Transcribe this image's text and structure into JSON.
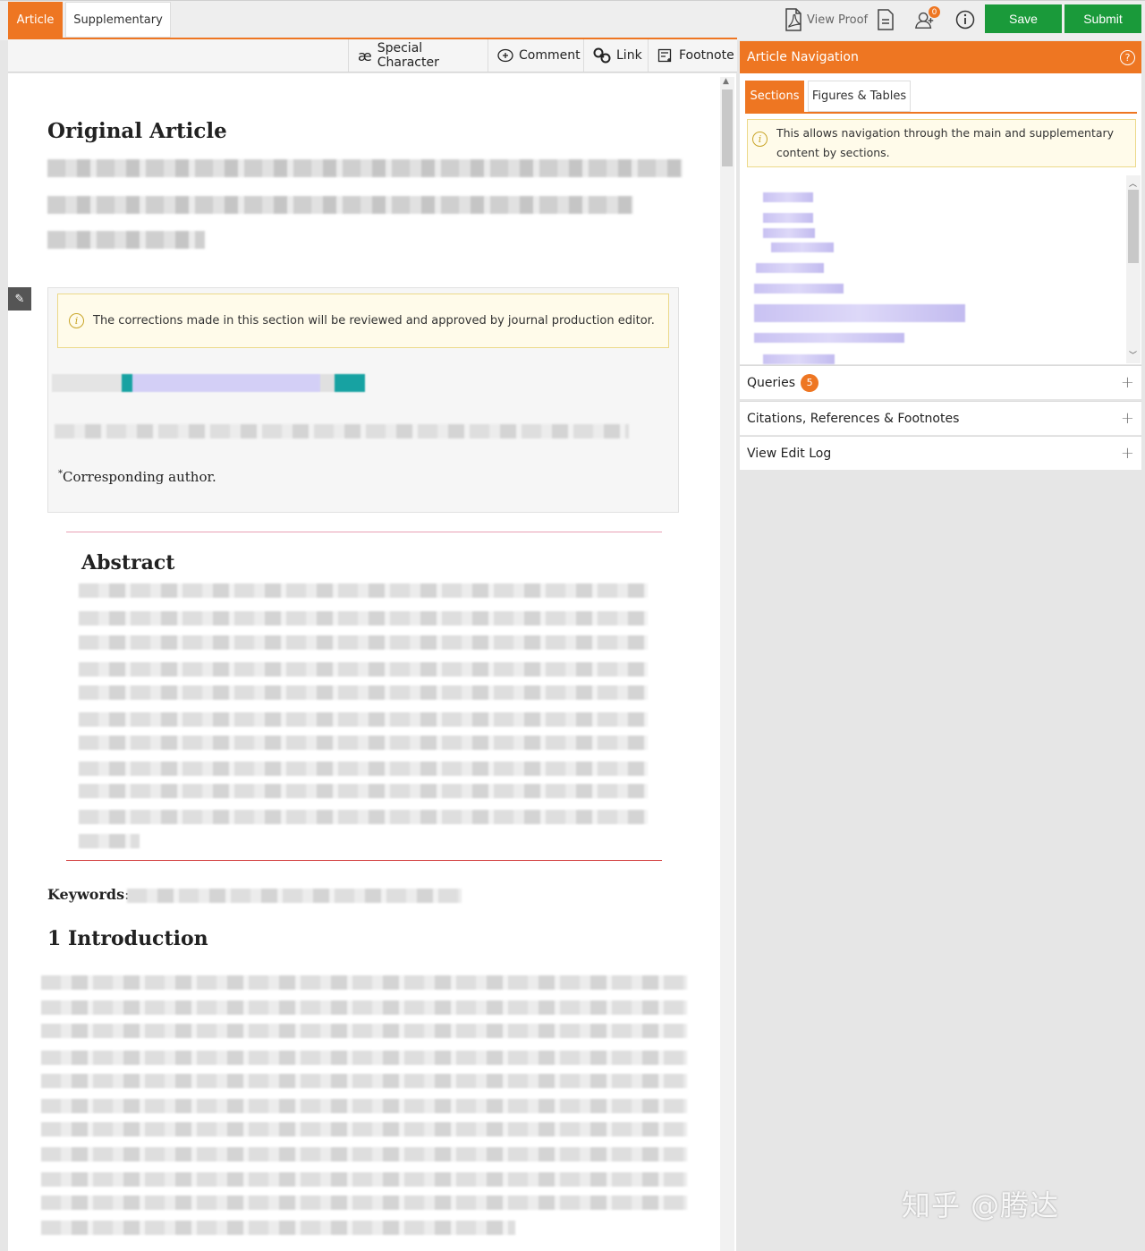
{
  "tabs": {
    "article": "Article",
    "supplementary": "Supplementary"
  },
  "topbar": {
    "view_proof": "View Proof",
    "notification_count": "0",
    "save": "Save",
    "submit": "Submit"
  },
  "toolbar": {
    "special_character": "Special Character",
    "comment": "Comment",
    "link": "Link",
    "footnote": "Footnote"
  },
  "document": {
    "article_type": "Original Article",
    "notice": "The corrections made in this section will be reviewed and approved by journal production editor.",
    "corresponding_mark": "*",
    "corresponding_author": "Corresponding author.",
    "abstract_heading": "Abstract",
    "keywords_label": "Keywords",
    "keywords_sep": ":",
    "intro_heading": "1 Introduction"
  },
  "navigation": {
    "title": "Article Navigation",
    "help": "?",
    "tab_sections": "Sections",
    "tab_figures": "Figures & Tables",
    "notice": "This allows navigation through the main and supplementary content by sections.",
    "accordions": {
      "queries": "Queries",
      "queries_count": "5",
      "citations": "Citations, References & Footnotes",
      "edit_log": "View Edit Log"
    }
  },
  "watermark": "知乎 @腾达",
  "colors": {
    "accent": "#ee7622",
    "success": "#1a9a3a",
    "notice_bg": "#fffbea"
  }
}
